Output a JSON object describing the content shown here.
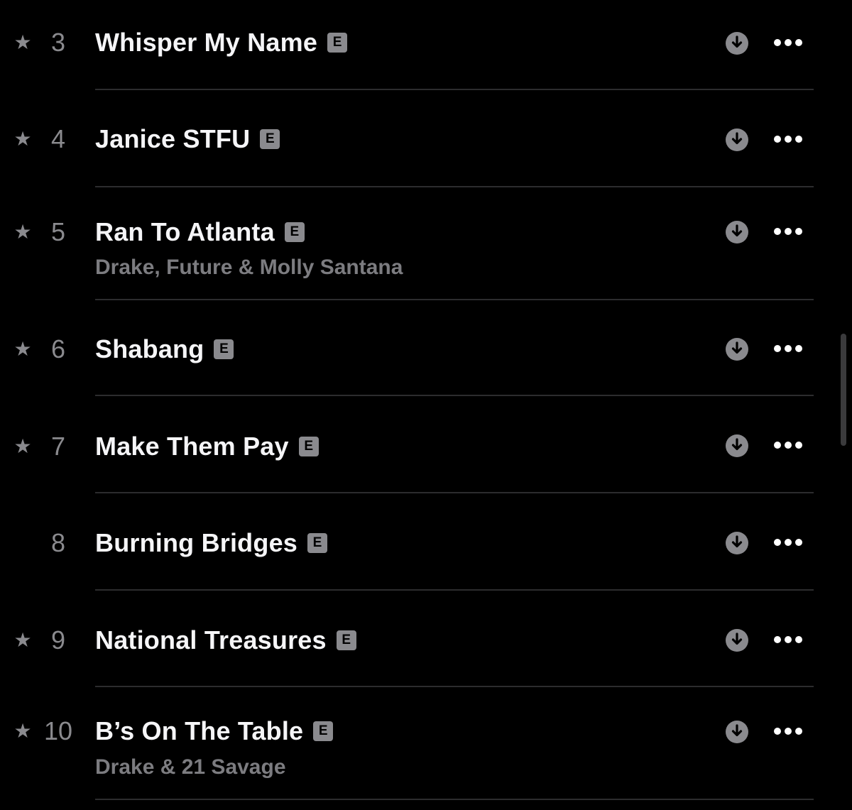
{
  "tracks": [
    {
      "starred": true,
      "number": "3",
      "title": "Whisper My Name",
      "explicit": "E",
      "artist": ""
    },
    {
      "starred": true,
      "number": "4",
      "title": "Janice STFU",
      "explicit": "E",
      "artist": ""
    },
    {
      "starred": true,
      "number": "5",
      "title": "Ran To Atlanta",
      "explicit": "E",
      "artist": "Drake, Future & Molly Santana"
    },
    {
      "starred": true,
      "number": "6",
      "title": "Shabang",
      "explicit": "E",
      "artist": ""
    },
    {
      "starred": true,
      "number": "7",
      "title": "Make Them Pay",
      "explicit": "E",
      "artist": ""
    },
    {
      "starred": false,
      "number": "8",
      "title": "Burning Bridges",
      "explicit": "E",
      "artist": ""
    },
    {
      "starred": true,
      "number": "9",
      "title": "National Treasures",
      "explicit": "E",
      "artist": ""
    },
    {
      "starred": true,
      "number": "10",
      "title": "B’s On The Table",
      "explicit": "E",
      "artist": "Drake & 21 Savage"
    }
  ],
  "icons": {
    "star": "star-icon",
    "download": "download-circle-icon",
    "more": "more-ellipsis-icon"
  },
  "colors": {
    "background": "#000000",
    "title": "#f5f5f7",
    "secondary": "#8a8a8e",
    "artist": "#7c7c80",
    "divider": "#2c2c2e"
  }
}
